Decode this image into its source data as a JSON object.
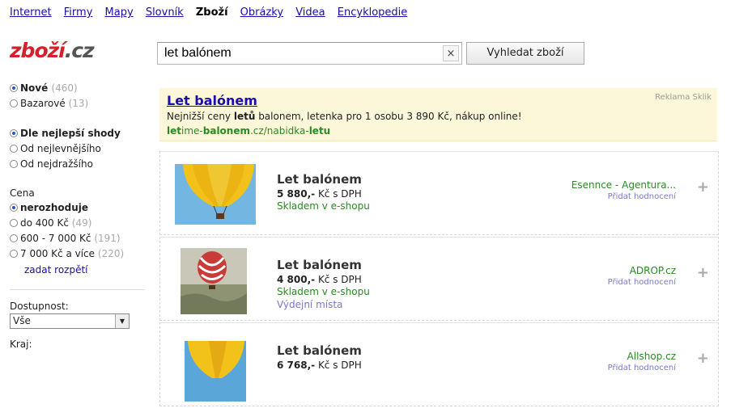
{
  "topnav": [
    "Internet",
    "Firmy",
    "Mapy",
    "Slovník",
    "Zboží",
    "Obrázky",
    "Videa",
    "Encyklopedie"
  ],
  "topnav_active": "Zboží",
  "logo": {
    "text": "zboží",
    ".cz": ".cz"
  },
  "search": {
    "value": "let balónem",
    "button_label": "Vyhledat zboží",
    "clear_symbol": "×"
  },
  "sidebar": {
    "condition": [
      {
        "label": "Nové",
        "count": "(460)",
        "selected": true
      },
      {
        "label": "Bazarové",
        "count": "(13)",
        "selected": false
      }
    ],
    "sort": [
      {
        "label": "Dle nejlepší shody",
        "selected": true
      },
      {
        "label": "Od nejlevnějšího",
        "selected": false
      },
      {
        "label": "Od nejdražšího",
        "selected": false
      }
    ],
    "price_label": "Cena",
    "price": [
      {
        "label": "nerozhoduje",
        "count": "",
        "selected": true
      },
      {
        "label": "do 400 Kč",
        "count": "(49)",
        "selected": false
      },
      {
        "label": "600 - 7 000 Kč",
        "count": "(191)",
        "selected": false
      },
      {
        "label": "7 000 Kč a více",
        "count": "(220)",
        "selected": false
      }
    ],
    "range_link": "zadat rozpětí",
    "availability_label": "Dostupnost:",
    "availability_value": "Vše",
    "region_label": "Kraj:"
  },
  "ad": {
    "title": "Let balónem",
    "desc_parts": [
      "Nejnižší ceny ",
      "letů",
      " balonem, letenka pro 1 osobu 3 890 Kč, nákup online!"
    ],
    "url_parts": [
      "let",
      "ime-",
      "balonem",
      ".cz/nabidka-",
      "letu"
    ],
    "label": "Reklama Sklik"
  },
  "products": [
    {
      "name": "Let balónem",
      "price": "5 880,-",
      "price_suffix": " Kč s DPH",
      "stock": "Skladem v e-shopu",
      "pickup": "",
      "shop": "Esennce - Agentura...",
      "rating": "Přidat hodnocení"
    },
    {
      "name": "Let balónem",
      "price": "4 800,-",
      "price_suffix": " Kč s DPH",
      "stock": "Skladem v e-shopu",
      "pickup": "Výdejní místa",
      "shop": "ADROP.cz",
      "rating": "Přidat hodnocení"
    },
    {
      "name": "Let balónem",
      "price": "6 768,-",
      "price_suffix": " Kč s DPH",
      "stock": "",
      "pickup": "",
      "shop": "Allshop.cz",
      "rating": "Přidat hodnocení"
    }
  ],
  "plus_symbol": "+",
  "colors": {
    "accent_link": "#1a0dab",
    "green": "#2a8a22",
    "ad_bg": "#fdf7da",
    "logo_red": "#d6202a"
  }
}
